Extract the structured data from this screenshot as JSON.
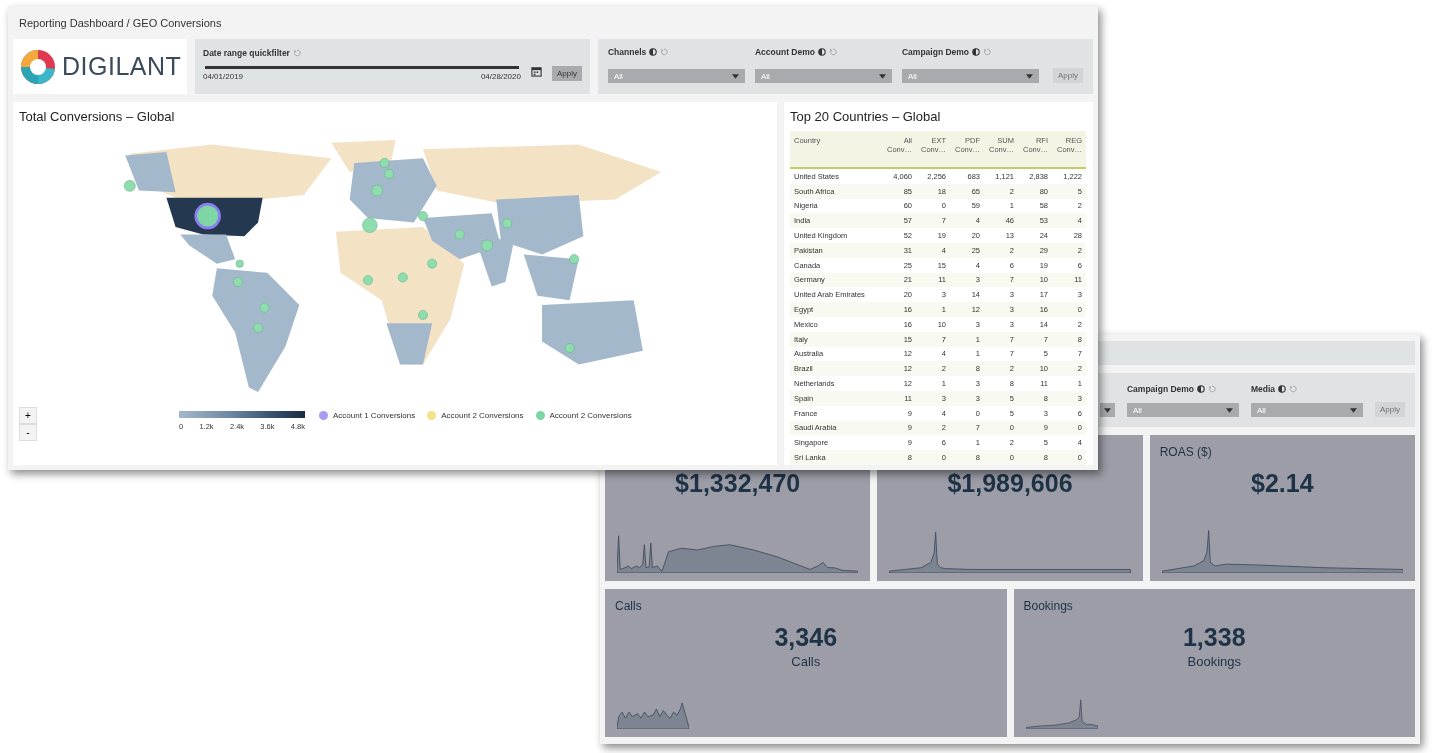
{
  "front_window": {
    "breadcrumb": "Reporting Dashboard / GEO Conversions",
    "logo": {
      "text": "DIGILANT"
    },
    "date_filter": {
      "label": "Date range quickfilter",
      "slider": {
        "level": 1
      },
      "start": "04/01/2019",
      "end": "04/28/2020",
      "apply": {
        "label": "Apply",
        "disabled": false
      }
    },
    "filters": [
      {
        "label": "Channels",
        "value": "All"
      },
      {
        "label": "Account Demo",
        "value": "All"
      },
      {
        "label": "Campaign Demo",
        "value": "All"
      }
    ],
    "filters_apply": {
      "label": "Apply",
      "disabled": true
    },
    "map_panel": {
      "title": "Total Conversions – Global",
      "zoom_buttons": [
        "+",
        "-"
      ],
      "scale_ticks": [
        "0",
        "1.2k",
        "2.4k",
        "3.6k",
        "4.8k"
      ],
      "legend": [
        {
          "label": "Account 1 Conversions",
          "color": "#a99cf0"
        },
        {
          "label": "Account 2 Conversions",
          "color": "#f6e08a"
        },
        {
          "label": "Account 2 Conversions",
          "color": "#7ed6a4"
        }
      ]
    },
    "table_panel": {
      "title": "Top 20 Countries – Global",
      "columns": [
        "Country",
        "All Conv…",
        "EXT Conv…",
        "PDF Conv…",
        "SUM Conv…",
        "RFI Conv…",
        "REG Conv…"
      ],
      "rows": [
        [
          "United States",
          "4,060",
          "2,256",
          "683",
          "1,121",
          "2,838",
          "1,222"
        ],
        [
          "South Africa",
          "85",
          "18",
          "65",
          "2",
          "80",
          "5"
        ],
        [
          "Nigeria",
          "60",
          "0",
          "59",
          "1",
          "58",
          "2"
        ],
        [
          "India",
          "57",
          "7",
          "4",
          "46",
          "53",
          "4"
        ],
        [
          "United Kingdom",
          "52",
          "19",
          "20",
          "13",
          "24",
          "28"
        ],
        [
          "Pakistan",
          "31",
          "4",
          "25",
          "2",
          "29",
          "2"
        ],
        [
          "Canada",
          "25",
          "15",
          "4",
          "6",
          "19",
          "6"
        ],
        [
          "Germany",
          "21",
          "11",
          "3",
          "7",
          "10",
          "11"
        ],
        [
          "United Arab Emirates",
          "20",
          "3",
          "14",
          "3",
          "17",
          "3"
        ],
        [
          "Egypt",
          "16",
          "1",
          "12",
          "3",
          "16",
          "0"
        ],
        [
          "Mexico",
          "16",
          "10",
          "3",
          "3",
          "14",
          "2"
        ],
        [
          "Italy",
          "15",
          "7",
          "1",
          "7",
          "7",
          "8"
        ],
        [
          "Australia",
          "12",
          "4",
          "1",
          "7",
          "5",
          "7"
        ],
        [
          "Brazil",
          "12",
          "2",
          "8",
          "2",
          "10",
          "2"
        ],
        [
          "Netherlands",
          "12",
          "1",
          "3",
          "8",
          "11",
          "1"
        ],
        [
          "Spain",
          "11",
          "3",
          "3",
          "5",
          "8",
          "3"
        ],
        [
          "France",
          "9",
          "4",
          "0",
          "5",
          "3",
          "6"
        ],
        [
          "Saudi Arabia",
          "9",
          "2",
          "7",
          "0",
          "9",
          "0"
        ],
        [
          "Singapore",
          "9",
          "6",
          "1",
          "2",
          "5",
          "4"
        ],
        [
          "Sri Lanka",
          "8",
          "0",
          "8",
          "0",
          "8",
          "0"
        ]
      ]
    }
  },
  "back_window": {
    "filters": [
      {
        "label": "Campaign Demo",
        "value": "All"
      },
      {
        "label": "Media",
        "value": "All"
      }
    ],
    "apply": {
      "label": "Apply",
      "disabled": true
    },
    "cards": [
      {
        "value": "$1,332,470"
      },
      {
        "value": "$1,989,606"
      },
      {
        "title": "ROAS ($)",
        "value": "$2.14"
      },
      {
        "title": "Calls",
        "value": "3,346",
        "caption": "Calls"
      },
      {
        "title": "Bookings",
        "value": "1,338",
        "caption": "Bookings"
      }
    ]
  }
}
